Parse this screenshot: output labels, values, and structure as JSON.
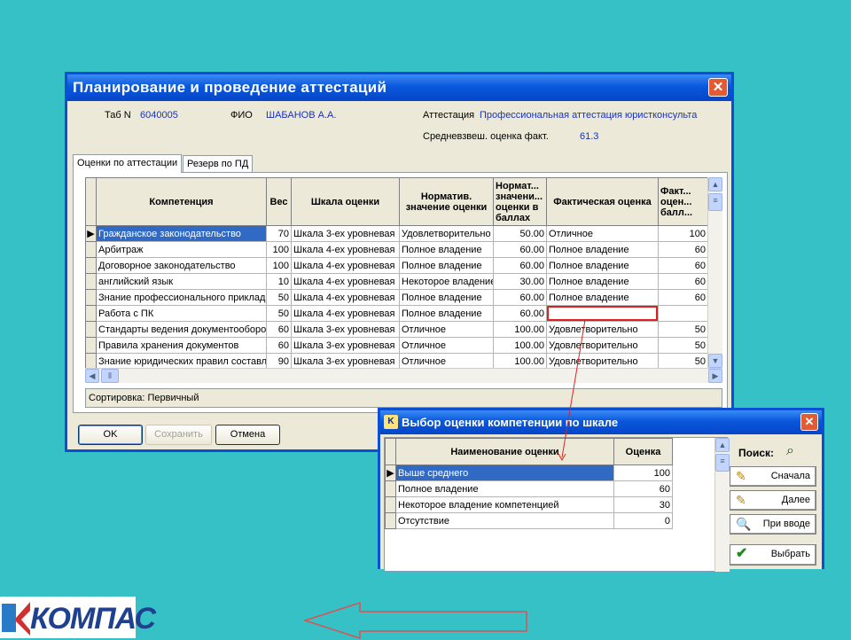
{
  "main_window": {
    "title": "Планирование и проведение аттестаций",
    "tab_label": "Таб N",
    "tab_value": "6040005",
    "fio_label": "ФИО",
    "fio_value": "ШАБАНОВ А.А.",
    "attestation_label": "Аттестация",
    "attestation_value": "Профессиональная аттестация юристконсульта",
    "avg_label": "Средневзвеш. оценка факт.",
    "avg_value": "61.3",
    "tabs": [
      "Оценки по аттестации",
      "Резерв по ПД"
    ],
    "columns": [
      "Компетенция",
      "Вес",
      "Шкала оценки",
      "Норматив. значение оценки",
      "Нормат... значени... оценки в баллах",
      "Фактическая оценка",
      "Факт... оцен... балл..."
    ],
    "rows": [
      [
        "Гражданское законодательство",
        "70",
        "Шкала  3-ех уровневая",
        "Удовлетворительно",
        "50.00",
        "Отличное",
        "100"
      ],
      [
        "Арбитраж",
        "100",
        "Шкала 4-ех уровневая",
        "Полное владение",
        "60.00",
        "Полное владение",
        "60"
      ],
      [
        "Договорное законодательство",
        "100",
        "Шкала 4-ех уровневая",
        "Полное владение",
        "60.00",
        "Полное владение",
        "60"
      ],
      [
        "английский язык",
        "10",
        "Шкала 4-ех уровневая",
        "Некоторое владение",
        "30.00",
        "Полное владение",
        "60"
      ],
      [
        "Знание профессионального приклад",
        "50",
        "Шкала 4-ех уровневая",
        "Полное владение",
        "60.00",
        "Полное владение",
        "60"
      ],
      [
        "Работа с ПК",
        "50",
        "Шкала 4-ех уровневая",
        "Полное владение",
        "60.00",
        "",
        ""
      ],
      [
        "Стандарты ведения документооборо",
        "60",
        "Шкала  3-ех уровневая",
        "Отличное",
        "100.00",
        "Удовлетворительно",
        "50"
      ],
      [
        "Правила хранения документов",
        "60",
        "Шкала  3-ех уровневая",
        "Отличное",
        "100.00",
        "Удовлетворительно",
        "50"
      ],
      [
        "Знание юридических правил составл",
        "90",
        "Шкала  3-ех уровневая",
        "Отличное",
        "100.00",
        "Удовлетворительно",
        "50"
      ]
    ],
    "sort_label": "Сортировка: Первичный",
    "ok_label": "OK",
    "save_label": "Сохранить",
    "cancel_label": "Отмена"
  },
  "dialog": {
    "title": "Выбор оценки компетенции по шкале",
    "columns": [
      "Наименование оценки",
      "Оценка"
    ],
    "rows": [
      [
        "Выше среднего",
        "100"
      ],
      [
        "Полное владение",
        "60"
      ],
      [
        "Некоторое владение компетенцией",
        "30"
      ],
      [
        "Отсутствие",
        "0"
      ]
    ],
    "search_label": "Поиск:",
    "btn_first": "Сначала",
    "btn_next": "Далее",
    "btn_on_input": "При вводе",
    "btn_select": "Выбрать"
  },
  "logo_text": "КОМПАС",
  "colors": {
    "background": "#35c1c6",
    "title_bar": "#0a57dc",
    "selection": "#316ac5",
    "highlight": "#e02020"
  }
}
